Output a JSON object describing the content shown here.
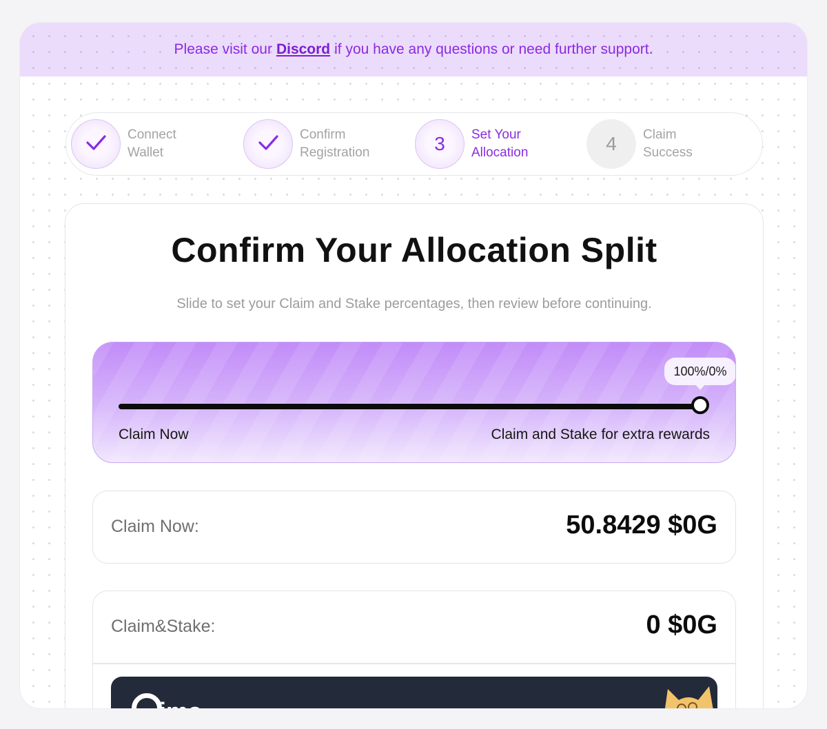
{
  "banner": {
    "prefix": "Please visit our",
    "link": "Discord",
    "suffix": "if you have any questions or need further support."
  },
  "steps": [
    {
      "marker": "",
      "icon": "check-icon",
      "line1": "Connect",
      "line2": "Wallet",
      "state": "done"
    },
    {
      "marker": "",
      "icon": "check-icon",
      "line1": "Confirm",
      "line2": "Registration",
      "state": "done"
    },
    {
      "marker": "3",
      "line1": "Set Your",
      "line2": "Allocation",
      "state": "active"
    },
    {
      "marker": "4",
      "line1": "Claim",
      "line2": "Success",
      "state": "pending"
    }
  ],
  "card": {
    "title": "Confirm Your Allocation Split",
    "subtitle": "Slide to set your Claim and Stake percentages, then review before continuing."
  },
  "slider": {
    "value_percent": 100,
    "bubble": "100%/0%",
    "left_label": "Claim Now",
    "right_label": "Claim and Stake for extra rewards"
  },
  "claim_now": {
    "label": "Claim Now:",
    "value": "50.8429 $0G"
  },
  "claim_stake": {
    "label": "Claim&Stake:",
    "value": "0 $0G"
  },
  "promo": {
    "logo_text": "ima"
  },
  "colors": {
    "accent": "#8a2be2",
    "banner_bg": "#ecdcfb",
    "promo_bg": "#232a3a"
  }
}
